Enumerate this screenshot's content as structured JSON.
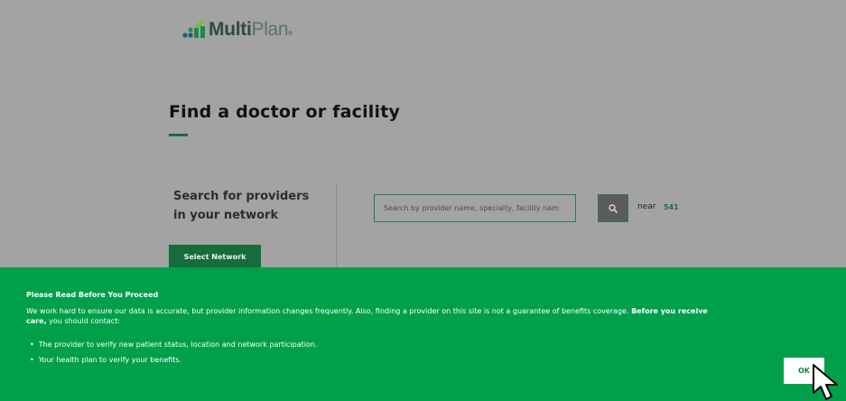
{
  "brand": {
    "name_bold": "Multi",
    "name_light": "Plan",
    "trademark": "®"
  },
  "page": {
    "title": "Find a doctor or facility"
  },
  "search": {
    "heading_line1": "Search for providers",
    "heading_line2": "in your network",
    "select_network_label": "Select Network",
    "input_placeholder": "Search by provider name, specialty, facility nam",
    "input_value": "",
    "near_label": "near",
    "near_value": "541"
  },
  "notice": {
    "title": "Please Read Before You Proceed",
    "body_start": "We work hard to ensure our data is accurate, but provider information changes frequently. Also, finding a provider on this site is not a guarantee of benefits coverage.",
    "body_bold": "Before you receive care,",
    "body_end": "you should contact:",
    "items": [
      "The provider to verify new patient status, location and network participation.",
      "Your health plan to verify your benefits."
    ],
    "ok_label": "OK"
  },
  "icons": {
    "logo": "multiplan-logo-icon",
    "search": "search-icon",
    "cursor": "mouse-cursor-icon"
  },
  "colors": {
    "brand_green": "#00a04a",
    "dark_green": "#166c3b",
    "overlay_gray": "#a3a3a3"
  }
}
